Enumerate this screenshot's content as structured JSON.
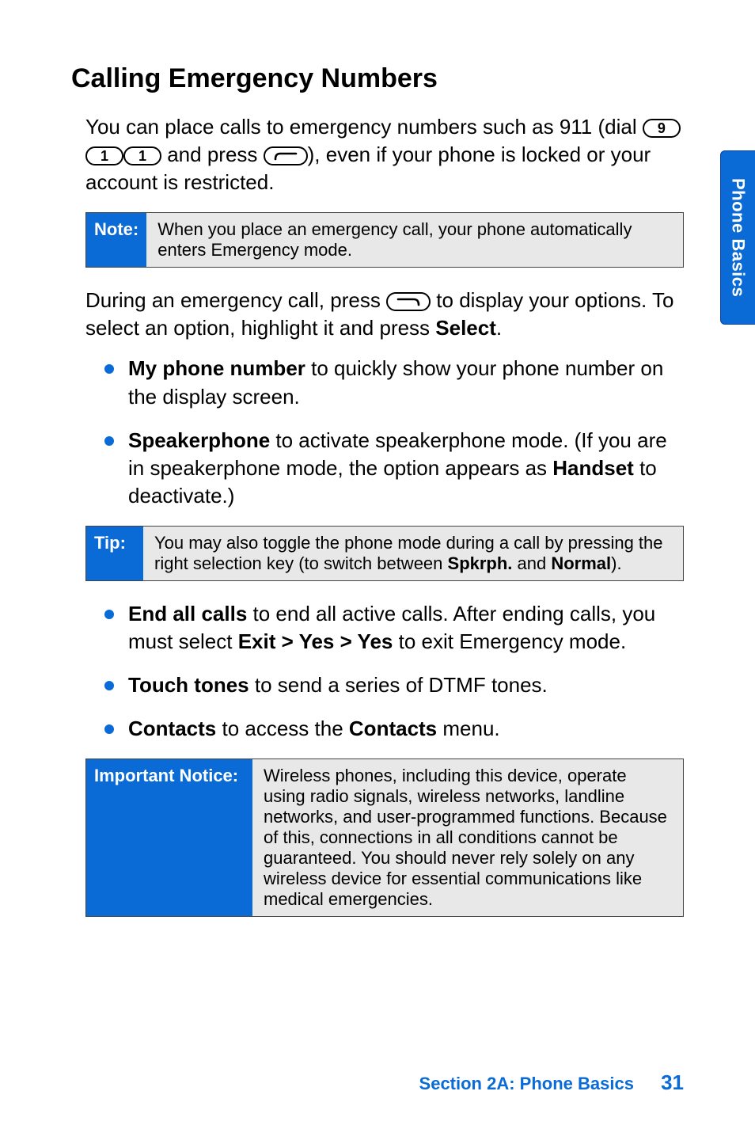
{
  "side_tab": "Phone Basics",
  "heading": "Calling Emergency Numbers",
  "intro": {
    "p1_a": "You can place calls to emergency numbers such as 911 (dial ",
    "key1": "9",
    "key2": "1",
    "key3": "1",
    "p1_b": " and press ",
    "p1_c": "), even if your phone is locked or your account is restricted."
  },
  "note": {
    "label": "Note:",
    "body": "When you place an emergency call, your phone automatically enters Emergency mode."
  },
  "during": {
    "p_a": "During an emergency call, press ",
    "p_b": " to display your options. To select an option, highlight it and press ",
    "select_label": "Select",
    "p_c": "."
  },
  "list1": {
    "i1_bold": "My phone number",
    "i1_rest": " to quickly show your phone number on the display screen.",
    "i2_bold": "Speakerphone",
    "i2_rest_a": " to activate speakerphone mode. (If you are in speakerphone mode, the option appears as ",
    "i2_handset": "Handset",
    "i2_rest_b": " to deactivate.)"
  },
  "tip": {
    "label": "Tip:",
    "body_a": "You may also toggle the phone mode during a call by pressing the right selection key (to switch between ",
    "b1": "Spkrph.",
    "body_b": " and ",
    "b2": "Normal",
    "body_c": ")."
  },
  "list2": {
    "i1_bold": "End all calls",
    "i1_rest_a": " to end all active calls. After ending calls, you must select ",
    "i1_path": "Exit > Yes > Yes",
    "i1_rest_b": " to exit Emergency mode.",
    "i2_bold": "Touch tones",
    "i2_rest": " to send a series of DTMF tones.",
    "i3_bold": "Contacts",
    "i3_rest_a": " to access the ",
    "i3_contacts": "Contacts",
    "i3_rest_b": " menu."
  },
  "notice": {
    "label": "Important Notice:",
    "body": "Wireless phones, including this device, operate using radio signals, wireless networks, landline networks, and user-programmed functions. Because of this, connections in all conditions cannot be guaranteed. You should never rely solely on any wireless device for essential communications like medical emergencies."
  },
  "footer": {
    "section": "Section 2A: Phone Basics",
    "page": "31"
  }
}
